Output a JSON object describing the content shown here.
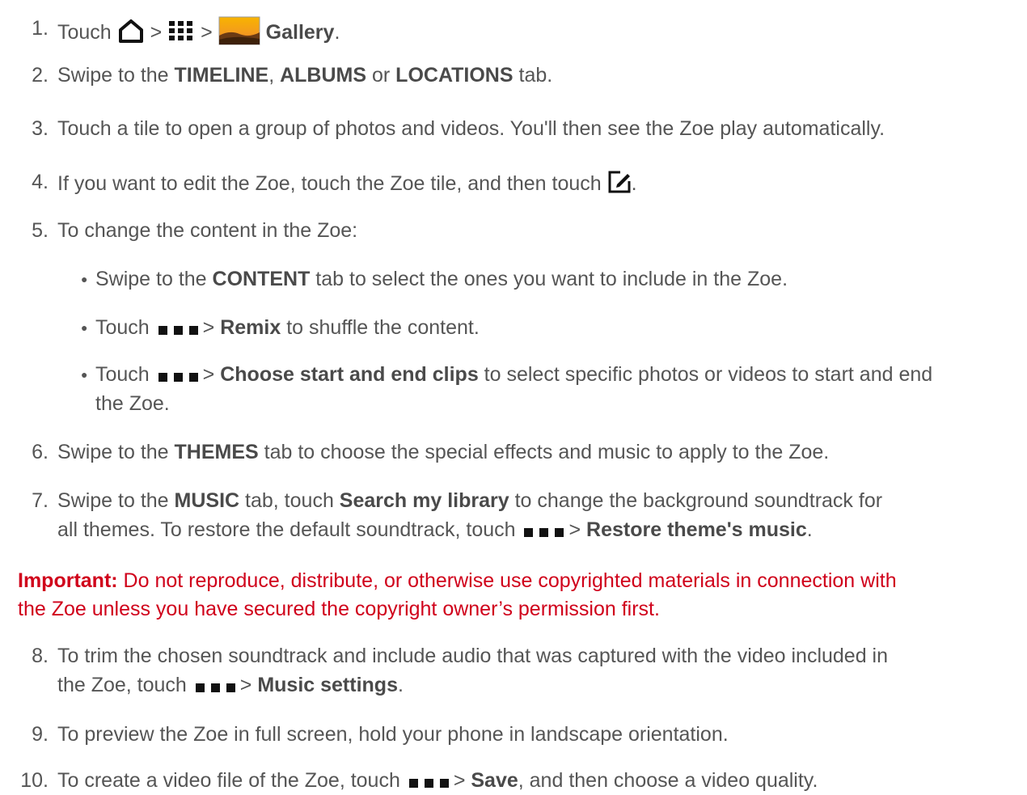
{
  "steps": [
    {
      "num": "1.",
      "parts": [
        "Touch",
        ">",
        ">",
        "Gallery",
        "."
      ]
    },
    {
      "num": "2.",
      "parts": [
        "Swipe to the ",
        "TIMELINE",
        ", ",
        "ALBUMS",
        " or ",
        "LOCATIONS",
        " tab."
      ]
    },
    {
      "num": "3.",
      "text": "Touch a tile to open a group of photos and videos. You'll then see the Zoe play automatically."
    },
    {
      "num": "4.",
      "parts": [
        "If you want to edit the Zoe, touch the Zoe tile, and then touch",
        "."
      ]
    },
    {
      "num": "5.",
      "text": "To change the content in the Zoe:"
    },
    {
      "num": "6.",
      "parts": [
        "Swipe to the ",
        "THEMES",
        " tab to choose the special effects and music to apply to the Zoe."
      ]
    },
    {
      "num": "7.",
      "parts": [
        "Swipe to the ",
        "MUSIC",
        " tab, touch ",
        "Search my library",
        " to change the background soundtrack for",
        "all themes. To restore the default soundtrack, touch",
        "> ",
        "Restore theme's music",
        "."
      ]
    },
    {
      "num": "8.",
      "parts": [
        "To trim the chosen soundtrack and include audio that was captured with the video included in",
        "the Zoe, touch",
        "> ",
        "Music settings",
        "."
      ]
    },
    {
      "num": "9.",
      "text": "To preview the Zoe in full screen, hold your phone in landscape orientation."
    },
    {
      "num": "10.",
      "parts": [
        "To create a video file of the Zoe, touch",
        "> ",
        "Save",
        ", and then choose a video quality."
      ]
    }
  ],
  "bullets": [
    {
      "parts": [
        "Swipe to the ",
        "CONTENT",
        " tab to select the ones you want to include in the Zoe."
      ]
    },
    {
      "parts": [
        "Touch",
        "> ",
        "Remix",
        " to shuffle the content."
      ]
    },
    {
      "parts": [
        "Touch",
        "> ",
        "Choose start and end clips",
        " to select specific photos or videos to start and end",
        "the Zoe."
      ]
    }
  ],
  "important": {
    "label": "Important:",
    "line1": " Do not reproduce, distribute, or otherwise use copyrighted materials in connection with",
    "line2": "the Zoe unless you have secured the copyright owner’s permission first."
  },
  "icons": [
    "home-icon",
    "apps-grid-icon",
    "gallery-icon",
    "edit-icon",
    "menu-dots-icon"
  ],
  "colors": {
    "text": "#555555",
    "important": "#d0021b"
  }
}
